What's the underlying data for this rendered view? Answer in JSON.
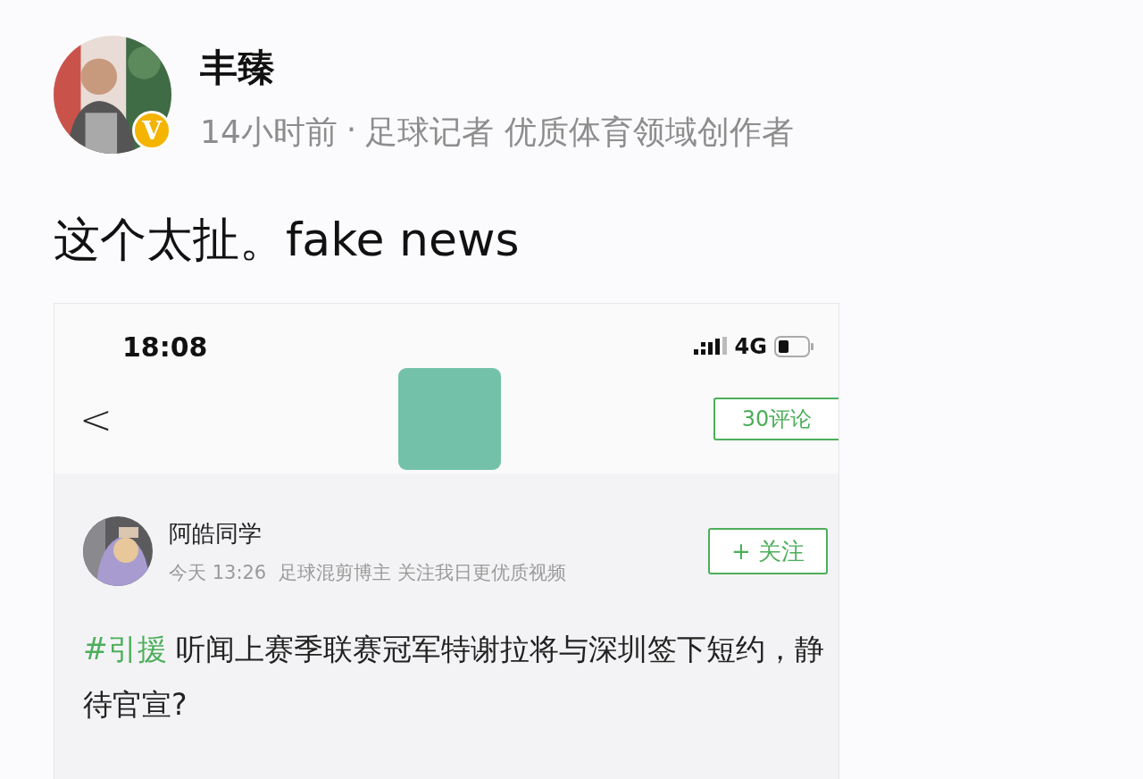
{
  "post": {
    "author": "丰臻",
    "verified_badge": "V",
    "time": "14小时前",
    "separator": "·",
    "author_bio": "足球记者 优质体育领域创作者",
    "text": "这个太扯。fake news"
  },
  "embedded_screenshot": {
    "status_bar": {
      "time": "18:08",
      "network": "4G"
    },
    "nav": {
      "back": "<",
      "comments_button": "30评论"
    },
    "author": {
      "name": "阿皓同学",
      "time": "今天 13:26",
      "bio": "足球混剪博主 关注我日更优质视频",
      "follow_button": "+ 关注"
    },
    "hashtag": "#引援",
    "text": "听闻上赛季联赛冠军特谢拉将与深圳签下短约，静待官宣?"
  }
}
